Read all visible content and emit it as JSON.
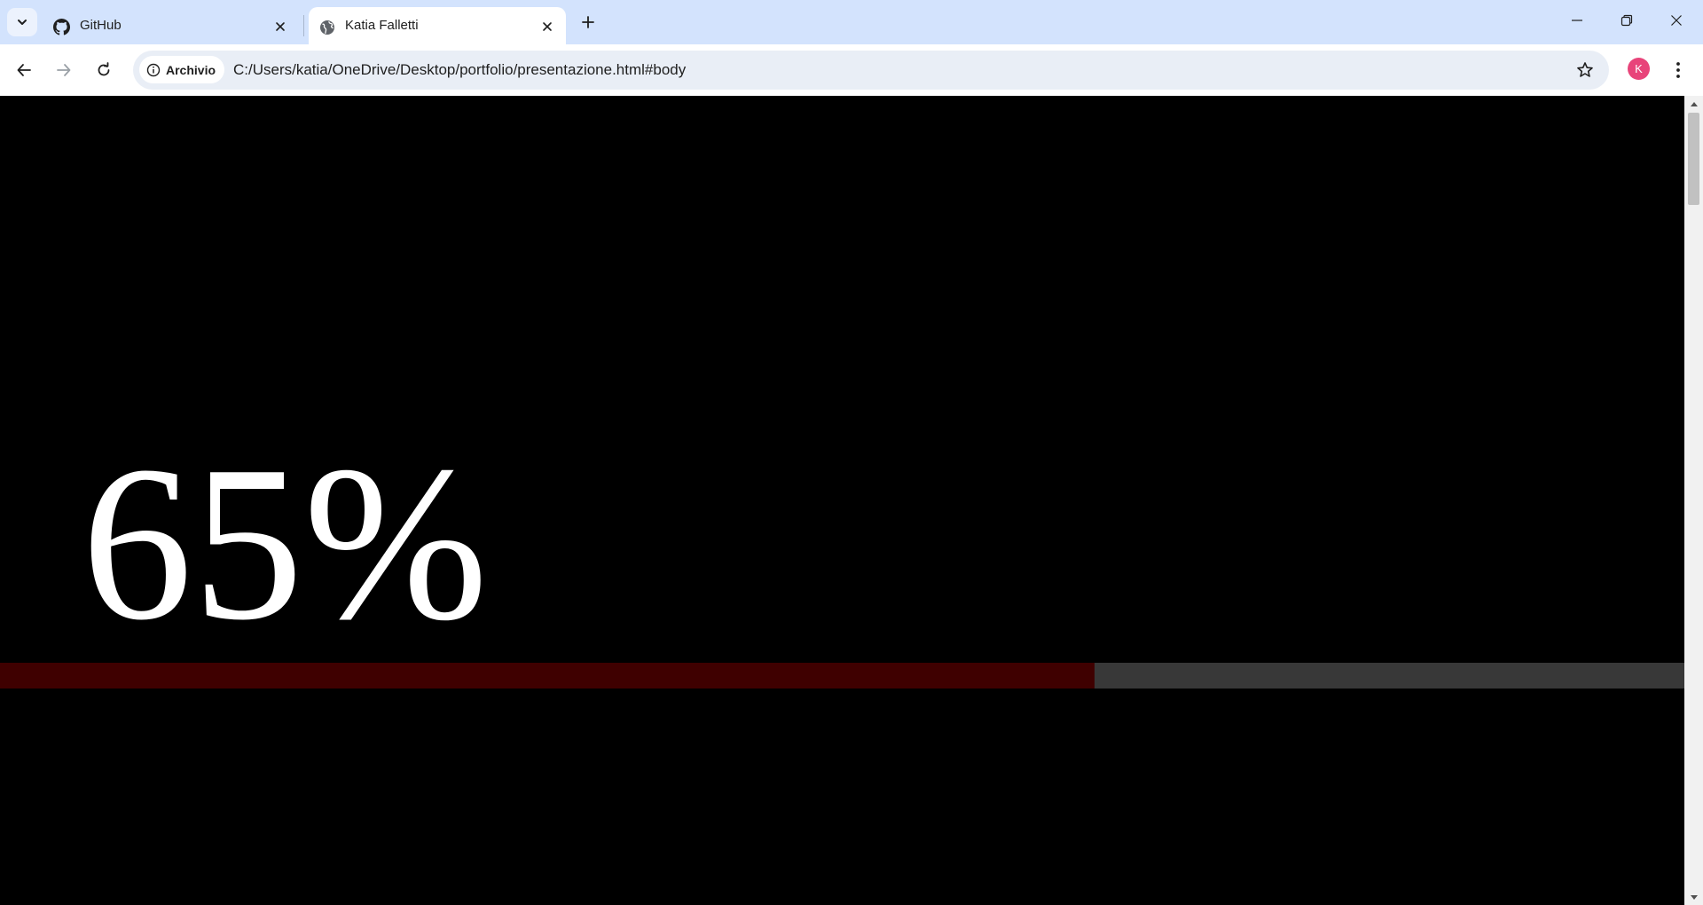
{
  "browser": {
    "tabs": [
      {
        "title": "GitHub",
        "favicon": "github-icon",
        "active": false
      },
      {
        "title": "Katia Falletti",
        "favicon": "globe-icon",
        "active": true
      }
    ],
    "address_bar": {
      "security_chip": "Archivio",
      "url": "C:/Users/katia/OneDrive/Desktop/portfolio/presentazione.html#body"
    },
    "profile_initial": "K",
    "profile_color": "#e8447a"
  },
  "page": {
    "percent_label": "65%",
    "progress_value": 65,
    "progress_fill_color": "#3f0000",
    "progress_track_color": "#383838",
    "background_color": "#000000"
  }
}
